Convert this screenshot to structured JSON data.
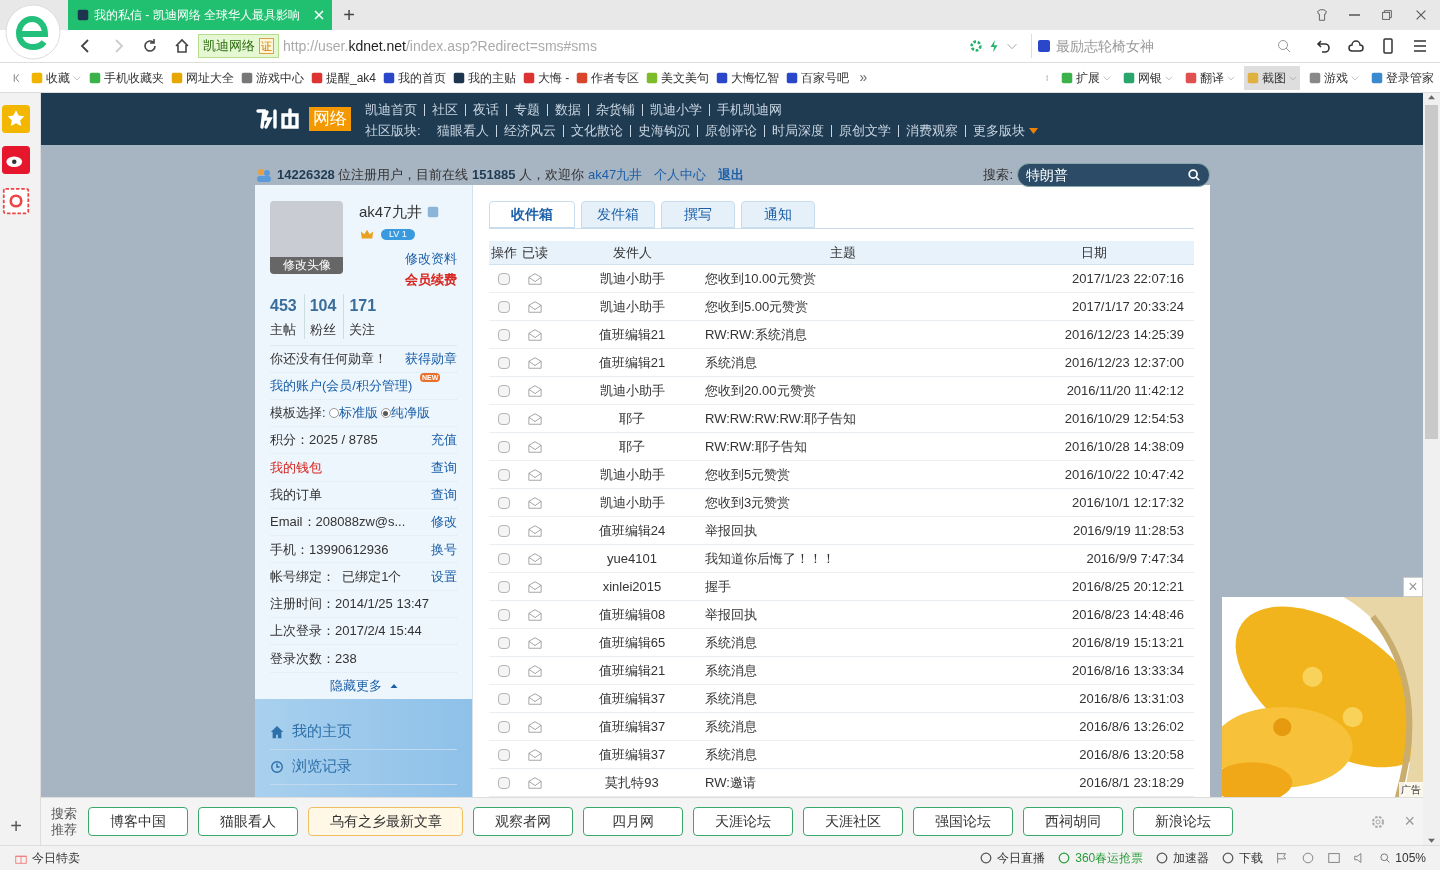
{
  "browser": {
    "tab": {
      "title": "我的私信 - 凯迪网络 全球华人最具影响",
      "selected": true
    },
    "new_tab": "+",
    "site_badge": "凯迪网络",
    "cert": "证",
    "url": {
      "prefix": "http://user.",
      "domain": "kdnet.net",
      "path": "/index.asp?Redirect=sms#sms"
    },
    "search": {
      "placeholder": "最励志轮椅女神"
    }
  },
  "bookmarks": [
    {
      "label": "收藏",
      "dropdown": true
    },
    {
      "label": "手机收藏夹",
      "dropdown": false
    },
    {
      "label": "网址大全",
      "dropdown": false
    },
    {
      "label": "游戏中心",
      "dropdown": false
    },
    {
      "label": "提醒_ak4",
      "dropdown": false
    },
    {
      "label": "我的首页",
      "dropdown": false
    },
    {
      "label": "我的主贴",
      "dropdown": false
    },
    {
      "label": "大悔 -",
      "dropdown": false
    },
    {
      "label": "作者专区",
      "dropdown": false
    },
    {
      "label": "美文美句",
      "dropdown": false
    },
    {
      "label": "大悔忆智",
      "dropdown": false
    },
    {
      "label": "百家号吧",
      "dropdown": false
    }
  ],
  "more_bookmarks": "»",
  "tools": [
    {
      "label": "扩展",
      "selected": false
    },
    {
      "label": "网银",
      "selected": false
    },
    {
      "label": "翻译",
      "selected": false
    },
    {
      "label": "截图",
      "selected": true
    },
    {
      "label": "游戏",
      "selected": false
    },
    {
      "label": "登录管家",
      "selected": false
    }
  ],
  "site": {
    "logo_text": "网络",
    "nav": [
      "凯迪首页",
      "社区",
      "夜话",
      "专题",
      "数据",
      "杂货铺",
      "凯迪小学",
      "手机凯迪网"
    ],
    "board_label": "社区版块:",
    "boards": [
      "猫眼看人",
      "经济风云",
      "文化散论",
      "史海钩沉",
      "原创评论",
      "时局深度",
      "原创文学",
      "消费观察",
      "更多版块"
    ],
    "welcome": {
      "users": "14226328",
      "users_text": "位注册用户，目前在线",
      "online": "151885",
      "online_text": "人，欢迎你",
      "username": "ak47九井",
      "center": "个人中心",
      "logout": "退出"
    },
    "search_label": "搜索:",
    "search_value": "特朗普"
  },
  "profile": {
    "avatar_caption": "修改头像",
    "name": "ak47九井",
    "level": "LV 1",
    "edit": "修改资料",
    "renew": "会员续费",
    "stats": [
      {
        "value": "453",
        "label": "主帖"
      },
      {
        "value": "104",
        "label": "粉丝"
      },
      {
        "value": "171",
        "label": "关注"
      }
    ],
    "medal": "你还没有任何勋章！",
    "medal_link": "获得勋章",
    "account": "我的账户(会员/积分管理)",
    "new_badge": "NEW",
    "template_label": "模板选择:",
    "templates": [
      {
        "label": "标准版",
        "selected": false
      },
      {
        "label": "纯净版",
        "selected": true
      }
    ],
    "rows": [
      {
        "label": "积分：2025 / 8785",
        "action": "充值",
        "highlight": false
      },
      {
        "label": "我的钱包",
        "action": "查询",
        "highlight": true
      },
      {
        "label": "我的订单",
        "action": "查询",
        "highlight": false
      },
      {
        "label": "Email：208088zw@s...",
        "action": "修改",
        "highlight": false
      },
      {
        "label": "手机：13990612936",
        "action": "换号",
        "highlight": false
      },
      {
        "label": "帐号绑定：  已绑定1个",
        "action": "设置",
        "highlight": false
      },
      {
        "label": "注册时间：2014/1/25 13:47",
        "highlight": false
      },
      {
        "label": "上次登录：2017/2/4 15:44",
        "highlight": false
      },
      {
        "label": "登录次数：238",
        "highlight": false
      }
    ],
    "collapse": "隐藏更多",
    "menu": [
      {
        "label": "我的主页",
        "kind": "home"
      },
      {
        "label": "浏览记录",
        "kind": "history"
      }
    ]
  },
  "mail_tabs": [
    {
      "label": "收件箱",
      "selected": true
    },
    {
      "label": "发件箱",
      "selected": false
    },
    {
      "label": "撰写",
      "selected": false
    },
    {
      "label": "通知",
      "selected": false
    }
  ],
  "table": {
    "columns": [
      "操作",
      "已读",
      "发件人",
      "主题",
      "日期"
    ],
    "rows": [
      {
        "checked": false,
        "sender": "凯迪小助手",
        "subject": "您收到10.00元赞赏",
        "date": "2017/1/23 22:07:16"
      },
      {
        "checked": false,
        "sender": "凯迪小助手",
        "subject": "您收到5.00元赞赏",
        "date": "2017/1/17 20:33:24"
      },
      {
        "checked": false,
        "sender": "值班编辑21",
        "subject": "RW:RW:系统消息",
        "date": "2016/12/23 14:25:39"
      },
      {
        "checked": false,
        "sender": "值班编辑21",
        "subject": "系统消息",
        "date": "2016/12/23 12:37:00"
      },
      {
        "checked": false,
        "sender": "凯迪小助手",
        "subject": "您收到20.00元赞赏",
        "date": "2016/11/20 11:42:12"
      },
      {
        "checked": false,
        "sender": "耶子",
        "subject": "RW:RW:RW:RW:耶子告知",
        "date": "2016/10/29 12:54:53"
      },
      {
        "checked": false,
        "sender": "耶子",
        "subject": "RW:RW:耶子告知",
        "date": "2016/10/28 14:38:09"
      },
      {
        "checked": false,
        "sender": "凯迪小助手",
        "subject": "您收到5元赞赏",
        "date": "2016/10/22 10:47:42"
      },
      {
        "checked": false,
        "sender": "凯迪小助手",
        "subject": "您收到3元赞赏",
        "date": "2016/10/1 12:17:32"
      },
      {
        "checked": false,
        "sender": "值班编辑24",
        "subject": "举报回执",
        "date": "2016/9/19 11:28:53"
      },
      {
        "checked": false,
        "sender": "yue4101",
        "subject": "我知道你后悔了！！！",
        "date": "2016/9/9 7:47:34"
      },
      {
        "checked": false,
        "sender": "xinlei2015",
        "subject": "握手",
        "date": "2016/8/25 20:12:21"
      },
      {
        "checked": false,
        "sender": "值班编辑08",
        "subject": "举报回执",
        "date": "2016/8/23 14:48:46"
      },
      {
        "checked": false,
        "sender": "值班编辑65",
        "subject": "系统消息",
        "date": "2016/8/19 15:13:21"
      },
      {
        "checked": false,
        "sender": "值班编辑21",
        "subject": "系统消息",
        "date": "2016/8/16 13:33:34"
      },
      {
        "checked": false,
        "sender": "值班编辑37",
        "subject": "系统消息",
        "date": "2016/8/6 13:31:03"
      },
      {
        "checked": false,
        "sender": "值班编辑37",
        "subject": "系统消息",
        "date": "2016/8/6 13:26:02"
      },
      {
        "checked": false,
        "sender": "值班编辑37",
        "subject": "系统消息",
        "date": "2016/8/6 13:20:58"
      },
      {
        "checked": false,
        "sender": "莫扎特93",
        "subject": "RW:邀请",
        "date": "2016/8/1 23:18:29"
      }
    ]
  },
  "ad": {
    "kind": "picture",
    "label": "广告",
    "close": "×"
  },
  "recommend": {
    "label": "搜索推荐",
    "items": [
      {
        "label": "博客中国",
        "selected": false
      },
      {
        "label": "猫眼看人",
        "selected": false
      },
      {
        "label": "乌有之乡最新文章",
        "selected": true
      },
      {
        "label": "观察者网",
        "selected": false
      },
      {
        "label": "四月网",
        "selected": false
      },
      {
        "label": "天涯论坛",
        "selected": false
      },
      {
        "label": "天涯社区",
        "selected": false
      },
      {
        "label": "强国论坛",
        "selected": false
      },
      {
        "label": "西祠胡同",
        "selected": false
      },
      {
        "label": "新浪论坛",
        "selected": false
      }
    ],
    "close": "×"
  },
  "sidebar_add": "+",
  "status": {
    "left": "今日特卖",
    "items": [
      {
        "label": "今日直播",
        "highlight": false
      },
      {
        "label": "360春运抢票",
        "highlight": true
      },
      {
        "label": "加速器",
        "highlight": false
      },
      {
        "label": "下载",
        "highlight": false
      }
    ],
    "zoom": "105%"
  }
}
